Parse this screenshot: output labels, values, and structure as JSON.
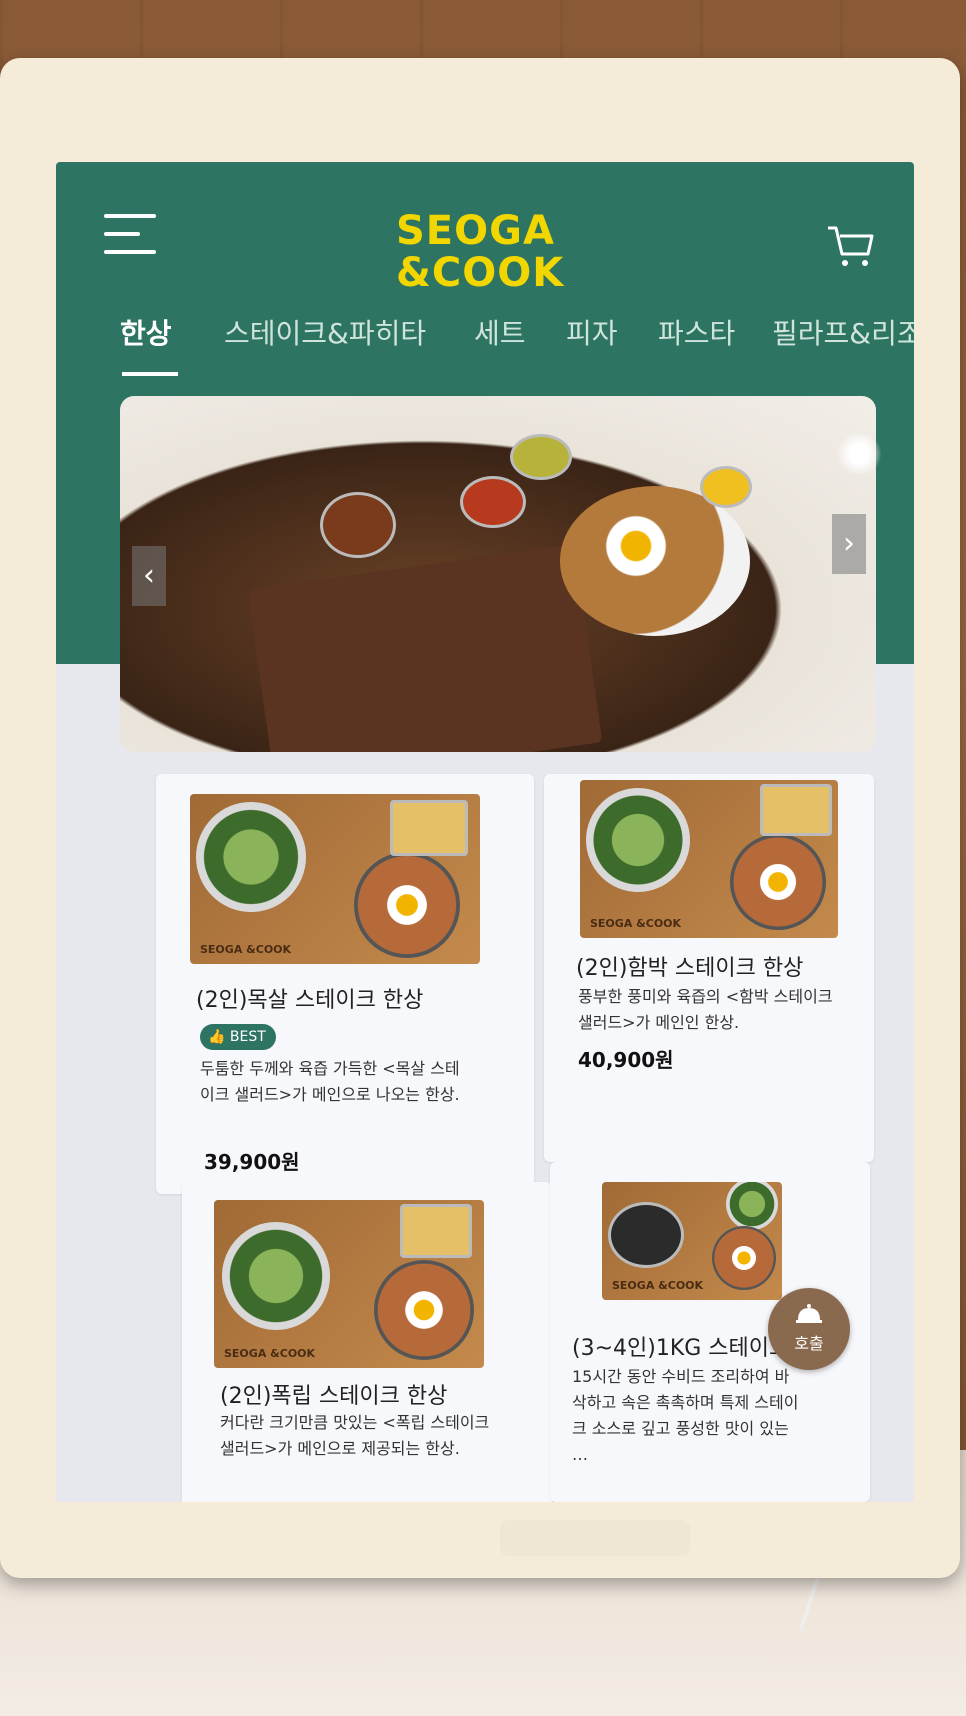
{
  "brand": {
    "logo_line1": "SEOGA",
    "logo_line2": "&COOK",
    "logo_color": "#f2d600",
    "header_color": "#2e7462"
  },
  "header": {
    "menu_icon": "hamburger-menu-icon",
    "cart_icon": "shopping-cart-icon"
  },
  "tabs": [
    {
      "label": "한상",
      "active": true
    },
    {
      "label": "스테이크&파히타",
      "active": false
    },
    {
      "label": "세트",
      "active": false
    },
    {
      "label": "피자",
      "active": false
    },
    {
      "label": "파스타",
      "active": false
    },
    {
      "label": "필라프&리조또",
      "active": false
    }
  ],
  "banner": {
    "prev_icon": "chevron-left-icon",
    "next_icon": "chevron-right-icon",
    "prev_glyph": "‹",
    "next_glyph": "›"
  },
  "menu_items": [
    {
      "title": "(2인)목살 스테이크 한상",
      "badge": "BEST",
      "description": "두툼한 두께와 육즙 가득한 <목살 스테이크 샐러드>가 메인으로 나오는 한상.",
      "price": "39,900원",
      "image_brand": "SEOGA &COOK"
    },
    {
      "title": "(2인)함박 스테이크 한상",
      "description": "풍부한 풍미와 육즙의 <함박 스테이크 샐러드>가 메인인 한상.",
      "price": "40,900원",
      "image_brand": "SEOGA &COOK"
    },
    {
      "title": "(2인)폭립 스테이크 한상",
      "description": "커다란 크기만큼 맛있는 <폭립 스테이크 샐러드>가 메인으로 제공되는 한상.",
      "image_brand": "SEOGA &COOK"
    },
    {
      "title": "(3~4인)1KG 스테이크 한",
      "description": "15시간 동안 수비드 조리하여 바삭하고 속은 촉촉하며 특제 스테이크 소스로 깊고 풍성한 맛이 있는 …",
      "image_brand": "SEOGA &COOK"
    }
  ],
  "call_button": {
    "label": "호출",
    "icon": "bell-icon"
  }
}
